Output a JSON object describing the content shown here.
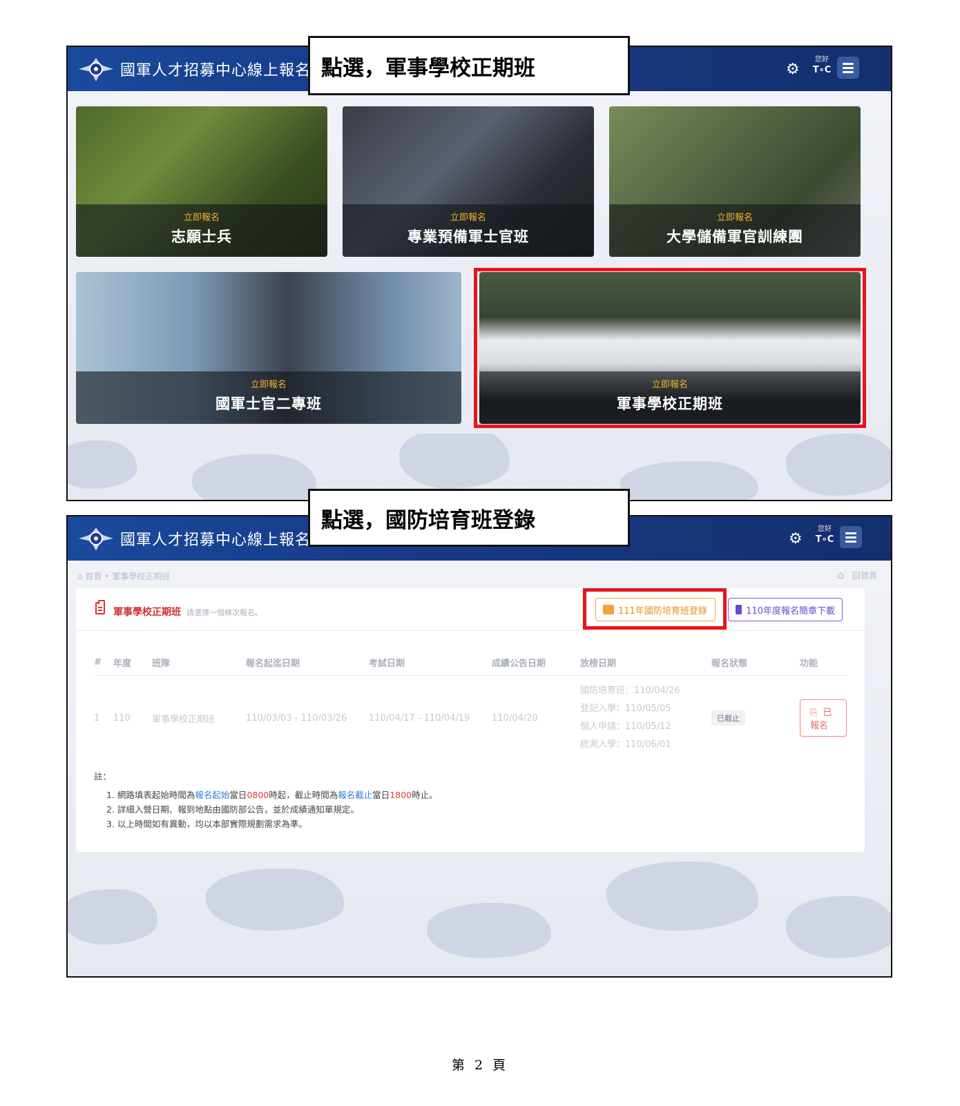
{
  "callouts": {
    "first": "點選，軍事學校正期班",
    "second": "點選，國防培育班登錄"
  },
  "header": {
    "site_title": "國軍人才招募中心線上報名",
    "greeting": "您好",
    "user": "T∘C"
  },
  "cards": [
    {
      "cta": "立即報名",
      "name": "志願士兵"
    },
    {
      "cta": "立即報名",
      "name": "專業預備軍士官班"
    },
    {
      "cta": "立即報名",
      "name": "大學儲備軍官訓練團"
    },
    {
      "cta": "立即報名",
      "name": "國軍士官二專班"
    },
    {
      "cta": "立即報名",
      "name": "軍事學校正期班"
    }
  ],
  "breadcrumb": {
    "home": "首頁",
    "current": "軍事學校正期班"
  },
  "home_link": "回首頁",
  "panel": {
    "title": "軍事學校正期班",
    "subtitle": "請選擇一個梯次報名。",
    "train_button": "111年國防培育班登錄",
    "guide_button": "110年度報名簡章下載"
  },
  "table": {
    "headers": [
      "#",
      "年度",
      "班隊",
      "報名起迄日期",
      "考試日期",
      "成績公告日期",
      "放榜日期",
      "報名狀態",
      "功能"
    ],
    "row": {
      "index": "1",
      "year": "110",
      "class": "軍事學校正期班",
      "signup": "110/03/03 - 110/03/26",
      "exam": "110/04/17 - 110/04/19",
      "score": "110/04/20",
      "release": [
        "國防培育班：110/04/26",
        "登記入學：110/05/05",
        "個人申請：110/05/12",
        "統測入學：110/06/01"
      ],
      "status": "已截止",
      "action": "已報名"
    }
  },
  "notes": {
    "title": "註：",
    "n1": {
      "a": "1. 網路填表起始時間為",
      "b": "報名起始",
      "c": "當日",
      "d": "0800",
      "e": "時起，截止時間為",
      "f": "報名截止",
      "g": "當日",
      "h": "1800",
      "i": "時止。"
    },
    "n2": "2. 詳細入營日期、報到地點由國防部公告，並於成績通知單規定。",
    "n3": "3. 以上時間如有異動，均以本部實際規劃需求為準。"
  },
  "page_number": "第 2 頁",
  "colors": {
    "accent_red": "#e8141c",
    "nav_blue": "#173c8a",
    "orange": "#f2a23a",
    "purple": "#6a4ad0"
  }
}
